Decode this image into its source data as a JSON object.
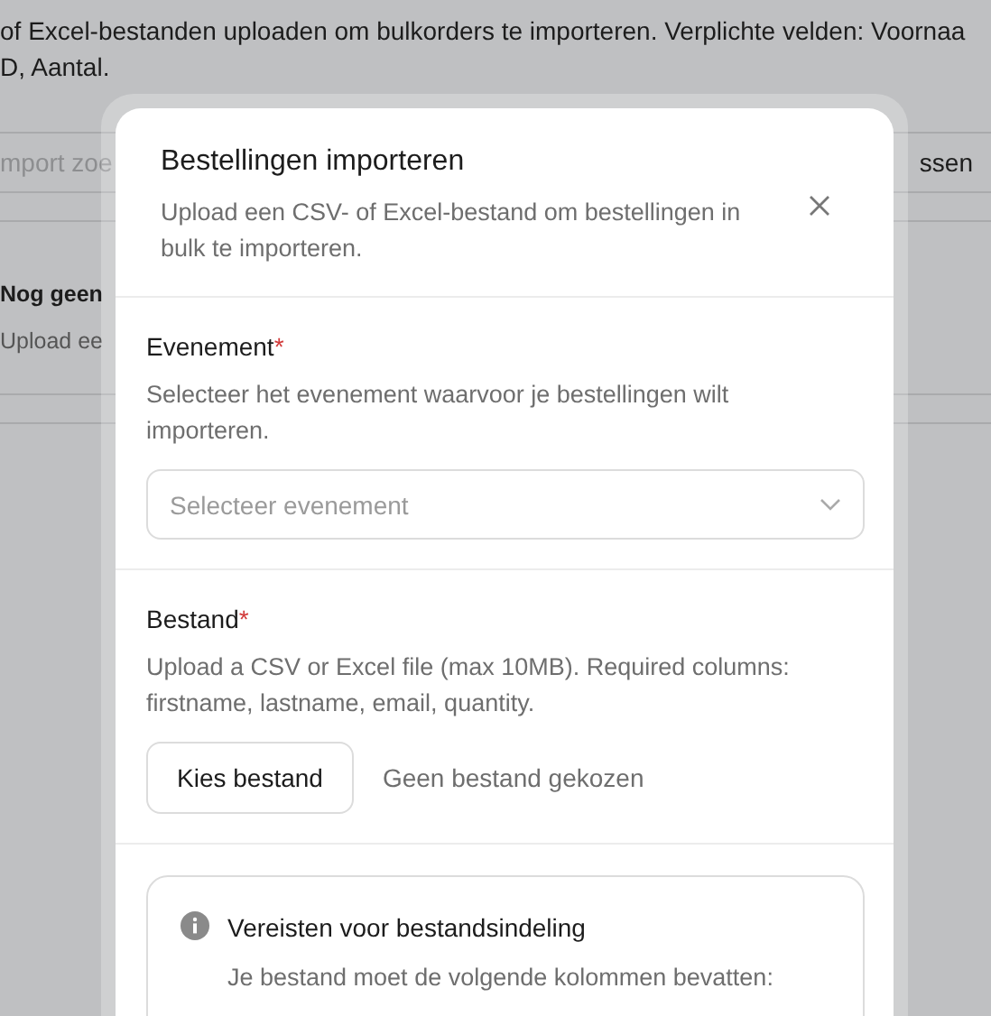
{
  "background": {
    "description_lines": [
      "of Excel-bestanden uploaden om bulkorders te importeren. Verplichte velden: Voornaa",
      "D, Aantal."
    ],
    "search_placeholder": "mport zoe",
    "button_label": "ssen",
    "empty_title": "Nog geen",
    "empty_text": "Upload ee"
  },
  "dialog": {
    "title": "Bestellingen importeren",
    "subtitle": "Upload een CSV- of Excel-bestand om bestellingen in bulk te importeren.",
    "fields": [
      {
        "kind": "select",
        "label": "Evenement",
        "required_mark": "*",
        "description": "Selecteer het evenement waarvoor je bestellingen wilt importeren.",
        "placeholder": "Selecteer evenement"
      },
      {
        "kind": "file",
        "label": "Bestand",
        "required_mark": "*",
        "description": "Upload a CSV or Excel file (max 10MB). Required columns: firstname, lastname, email, quantity.",
        "button": "Kies bestand",
        "status": "Geen bestand gekozen"
      }
    ],
    "info": {
      "title": "Vereisten voor bestandsindeling",
      "text": "Je bestand moet de volgende kolommen bevatten:"
    }
  }
}
